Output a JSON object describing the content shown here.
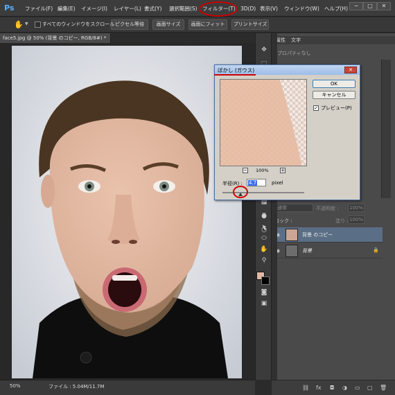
{
  "app": {
    "logo": "Ps",
    "menus": [
      "ファイル(F)",
      "編集(E)",
      "イメージ(I)",
      "レイヤー(L)",
      "書式(Y)",
      "選択範囲(S)",
      "フィルター(T)",
      "3D(D)",
      "表示(V)",
      "ウィンドウ(W)",
      "ヘルプ(H)"
    ],
    "highlighted_menu": "フィルター(T)",
    "window_controls": [
      "−",
      "□",
      "✕"
    ]
  },
  "options_bar": {
    "tool_icon": "hand-icon",
    "scroll_all_label": "すべてのウィンドウをスクロール",
    "buttons": [
      "ピクセル等倍",
      "画面サイズ",
      "画面にフィット",
      "プリントサイズ"
    ]
  },
  "document": {
    "tab_title": "face5.jpg @ 50% (背景 のコピー, RGB/8#) *",
    "zoom": "50%",
    "file_info": "ファイル : 5.04M/11.7M"
  },
  "panels": {
    "tabs": [
      "属性",
      "文字"
    ],
    "properties_empty": "プロパティなし",
    "blend_mode": "通常",
    "opacity_label": "不透明度 :",
    "opacity": "100%",
    "lock_label": "ロック :",
    "fill_label": "塗り :",
    "fill": "100%",
    "layers": [
      {
        "name": "背景 のコピー",
        "selected": true,
        "locked": false
      },
      {
        "name": "背景",
        "selected": false,
        "locked": true
      }
    ]
  },
  "dialog": {
    "title": "ぼかし (ガウス)",
    "close": "✕",
    "ok_label": "OK",
    "cancel_label": "キャンセル",
    "preview_label": "プレビュー(P)",
    "preview_checked": true,
    "zoom_pct": "100%",
    "radius_label": "半径(R) :",
    "radius_value": "4.7",
    "radius_unit": "pixel"
  },
  "colors": {
    "foreground": "#e3b9a3",
    "background": "#000000",
    "annotation": "#d10000"
  }
}
